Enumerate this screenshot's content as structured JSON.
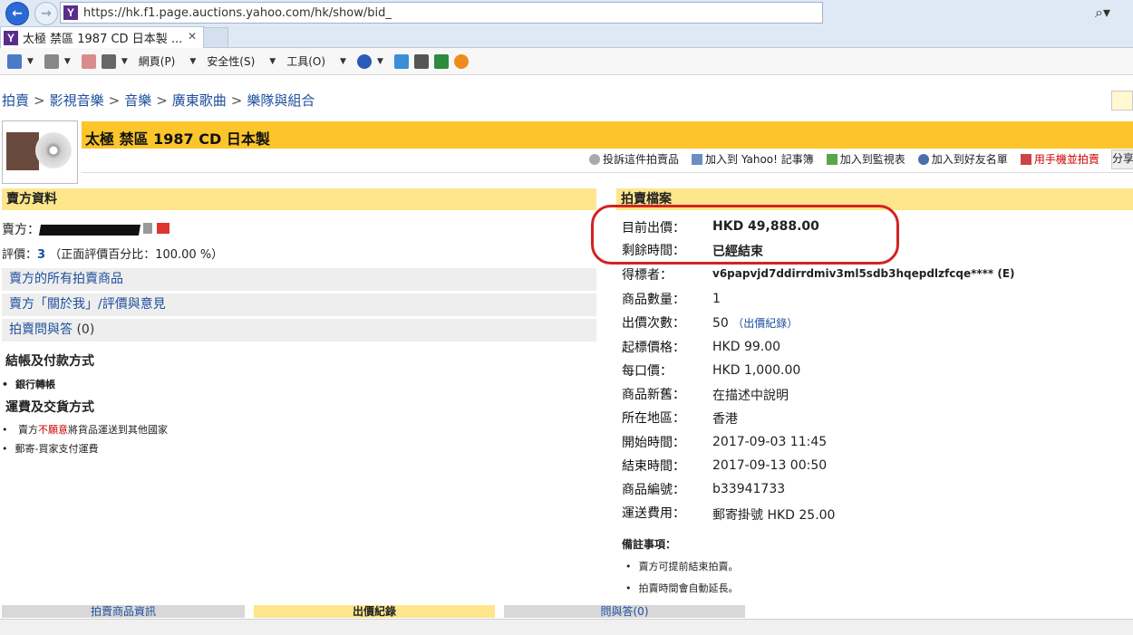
{
  "browser": {
    "url": "https://hk.f1.page.auctions.yahoo.com/hk/show/bid_",
    "tab_title": "太極 禁區 1987 CD 日本製 ...",
    "favicon_letter": "Y",
    "menus": [
      "網頁(P)",
      "安全性(S)",
      "工具(O)"
    ]
  },
  "breadcrumb": [
    "拍賣",
    "影視音樂",
    "音樂",
    "廣東歌曲",
    "樂隊與組合"
  ],
  "item": {
    "title": "太極 禁區 1987 CD 日本製"
  },
  "toolbar": {
    "report": "投訴這件拍賣品",
    "notebook": "加入到 Yahoo! 記事簿",
    "watch": "加入到監視表",
    "friends": "加入到好友名單",
    "mobile": "用手機並拍賣",
    "share": "分享"
  },
  "seller": {
    "header": "賣方資料",
    "label": "賣方：",
    "rating_label": "評價：",
    "rating_value": "3",
    "rating_note": "（正面評價百分比：100.00 %）",
    "links": [
      {
        "label": "賣方的所有拍賣商品",
        "count": ""
      },
      {
        "label": "賣方「關於我」/評價與意見",
        "count": ""
      },
      {
        "label": "拍賣問與答",
        "count": " (0)"
      }
    ],
    "payment_title": "結帳及付款方式",
    "payment_items": [
      "銀行轉帳"
    ],
    "shipping_title": "運費及交貨方式",
    "shipping_line1_a": "賣方",
    "shipping_line1_red": "不願意",
    "shipping_line1_b": "將貨品運送到其他國家",
    "shipping_line2": "郵寄-買家支付運費"
  },
  "auction": {
    "header": "拍賣檔案",
    "rows": [
      {
        "label": "目前出價：",
        "value": "HKD 49,888.00",
        "bold": true
      },
      {
        "label": "剩餘時間：",
        "value": "已經結束",
        "bold": true
      },
      {
        "label": "得標者：",
        "value": "v6papvjd7ddirrdmiv3ml5sdb3hqepdlzfcqe**** (E)"
      },
      {
        "label": "商品數量：",
        "value": "1"
      },
      {
        "label": "出價次數：",
        "value": "50",
        "extra": "（出價紀錄）"
      },
      {
        "label": "起標價格：",
        "value": "HKD 99.00"
      },
      {
        "label": "每口價：",
        "value": "HKD 1,000.00"
      },
      {
        "label": "商品新舊：",
        "value": "在描述中說明"
      },
      {
        "label": "所在地區：",
        "value": "香港"
      },
      {
        "label": "開始時間：",
        "value": "2017-09-03 11:45"
      },
      {
        "label": "結束時間：",
        "value": "2017-09-13 00:50"
      },
      {
        "label": "商品編號：",
        "value": "b33941733"
      },
      {
        "label": "運送費用：",
        "value": "郵寄掛號 HKD 25.00"
      }
    ],
    "notes_title": "備註事項：",
    "notes": [
      "賣方可提前結束拍賣。",
      "拍賣時間會自動延長。"
    ]
  },
  "bottom_tabs": [
    "拍賣商品資訊",
    "出價紀錄",
    "問與答(0)"
  ]
}
